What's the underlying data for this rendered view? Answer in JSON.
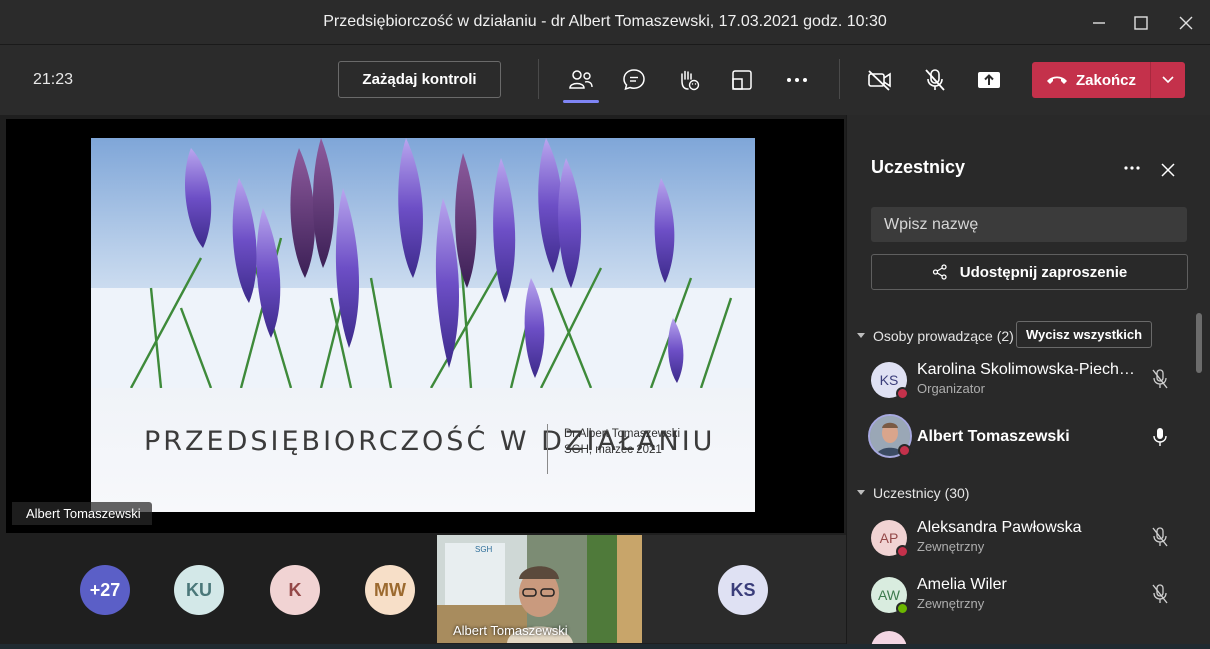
{
  "window": {
    "title": "Przedsiębiorczość w działaniu - dr Albert Tomaszewski, 17.03.2021 godz. 10:30"
  },
  "toolbar": {
    "timer": "21:23",
    "request_control_label": "Zażądaj kontroli",
    "end_label": "Zakończ",
    "accent_color": "#c4314b",
    "icons": [
      "participants-icon",
      "chat-icon",
      "reactions-icon",
      "rooms-icon",
      "more-icon",
      "camera-off-icon",
      "mic-off-icon",
      "share-tray-icon"
    ]
  },
  "stage": {
    "slide": {
      "title": "PRZEDSIĘBIORCZOŚĆ W DZIAŁANIU",
      "author_line1": "Dr Albert Tomaszewski",
      "author_line2": "SGH, marzec 2021"
    },
    "presenter_name": "Albert Tomaszewski",
    "gallery": [
      {
        "initials": "+27",
        "color": "#5b5fc7"
      },
      {
        "initials": "KU",
        "color": "#d3e8e8"
      },
      {
        "initials": "K",
        "color": "#f1d3d3"
      },
      {
        "initials": "MW",
        "color": "#f7dfc8"
      }
    ],
    "video_name": "Albert Tomaszewski",
    "video_sign": "SGH",
    "ks_initials": "KS"
  },
  "panel": {
    "title": "Uczestnicy",
    "search_placeholder": "Wpisz nazwę",
    "share_invite_label": "Udostępnij zaproszenie",
    "presenters_section": "Osoby prowadzące (2)",
    "mute_all_label": "Wycisz wszystkich",
    "attendees_section": "Uczestnicy (30)",
    "presenters": [
      {
        "initials": "KS",
        "name": "Karolina Skolimowska-Piecho...",
        "role": "Organizator",
        "badge": "#c4314b",
        "mic": "off"
      },
      {
        "initials": "",
        "name": "Albert Tomaszewski",
        "role": "",
        "badge": "#c4314b",
        "mic": "on"
      }
    ],
    "attendees": [
      {
        "initials": "AP",
        "name": "Aleksandra Pawłowska",
        "role": "Zewnętrzny",
        "badge": "#c4314b",
        "mic": "off"
      },
      {
        "initials": "AW",
        "name": "Amelia Wiler",
        "role": "Zewnętrzny",
        "badge": "#6bb700",
        "mic": "off"
      }
    ]
  }
}
